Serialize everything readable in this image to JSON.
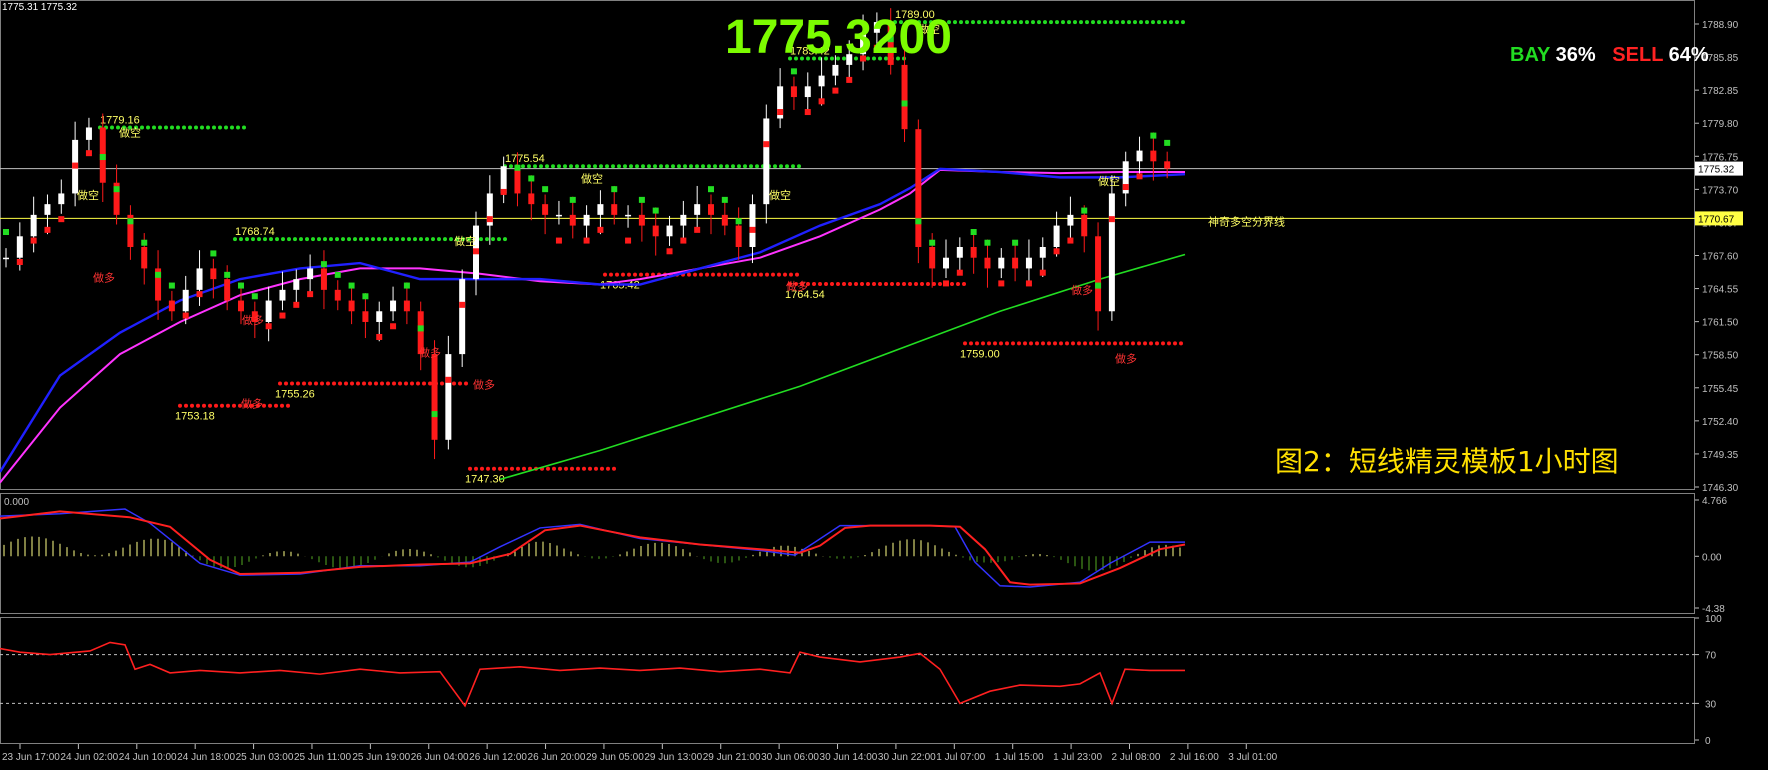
{
  "top_readout": "1775.31 1775.32",
  "big_price": "1775.3200",
  "sentiment": {
    "bay_label": "BAY",
    "bay_pct": "36%",
    "sell_label": "SELL",
    "sell_pct": "64%"
  },
  "caption": "图2：短线精灵模板1小时图",
  "divider_label": "神奇多空分界线",
  "colors": {
    "background": "#000000",
    "axis": "#c0c0c0",
    "buy": "#ff1a1a",
    "sell": "#22dd22",
    "ma_blue": "#2020ff",
    "ma_magenta": "#ff33ff",
    "ma_green": "#22dd22",
    "label_yellow": "#ffff66",
    "label_red": "#ff3333",
    "price_line": "#ffffff"
  },
  "chart_data": [
    {
      "type": "candlestick",
      "panel": "price",
      "ylim": [
        1745.5,
        1790.5
      ],
      "y_ticks": [
        "1788.90",
        "1785.85",
        "1782.85",
        "1779.80",
        "1776.75",
        "1773.70",
        "1770.67",
        "1767.60",
        "1764.55",
        "1761.50",
        "1758.50",
        "1755.45",
        "1752.40",
        "1749.35",
        "1746.30"
      ],
      "x_ticks": [
        "23 Jun 17:00",
        "24 Jun 02:00",
        "24 Jun 10:00",
        "24 Jun 18:00",
        "25 Jun 03:00",
        "25 Jun 11:00",
        "25 Jun 19:00",
        "26 Jun 04:00",
        "26 Jun 12:00",
        "26 Jun 20:00",
        "29 Jun 05:00",
        "29 Jun 13:00",
        "29 Jun 21:00",
        "30 Jun 06:00",
        "30 Jun 14:00",
        "30 Jun 22:00",
        "1 Jul 07:00",
        "1 Jul 15:00",
        "1 Jul 23:00",
        "2 Jul 08:00",
        "2 Jul 16:00",
        "3 Jul 01:00"
      ],
      "current_price": "1775.32",
      "current_price_value": 1775.32,
      "divider_price": "1770.67",
      "divider_price_value": 1770.67,
      "close_path": [
        1767,
        1769,
        1771,
        1772,
        1773,
        1778,
        1779.16,
        1774,
        1771,
        1768,
        1766,
        1763,
        1762,
        1764,
        1766,
        1765,
        1763,
        1762,
        1761,
        1763,
        1764,
        1765,
        1766,
        1764,
        1763,
        1762,
        1761,
        1762,
        1763,
        1762,
        1758,
        1750,
        1758,
        1765,
        1770,
        1773,
        1775.54,
        1773,
        1772,
        1771,
        1771,
        1770,
        1771,
        1772,
        1771,
        1771,
        1770,
        1769,
        1770,
        1771,
        1772,
        1771,
        1770,
        1768,
        1772,
        1780,
        1783,
        1782,
        1783,
        1784,
        1785,
        1786,
        1788,
        1789,
        1785,
        1779,
        1768,
        1766,
        1767,
        1768,
        1767,
        1766,
        1767,
        1766,
        1767,
        1768,
        1770,
        1771,
        1769,
        1762,
        1773,
        1776,
        1777,
        1776,
        1775.32
      ],
      "ma_blue": [
        [
          0,
          1747
        ],
        [
          60,
          1756
        ],
        [
          120,
          1760
        ],
        [
          180,
          1763
        ],
        [
          240,
          1765
        ],
        [
          300,
          1766
        ],
        [
          360,
          1766.5
        ],
        [
          420,
          1765
        ],
        [
          480,
          1765
        ],
        [
          540,
          1765
        ],
        [
          600,
          1764.5
        ],
        [
          640,
          1764.5
        ],
        [
          700,
          1766
        ],
        [
          760,
          1767.5
        ],
        [
          820,
          1770
        ],
        [
          880,
          1772
        ],
        [
          910,
          1773.5
        ],
        [
          940,
          1775.3
        ],
        [
          1000,
          1775
        ],
        [
          1060,
          1774.5
        ],
        [
          1120,
          1774.5
        ],
        [
          1185,
          1774.8
        ]
      ],
      "ma_magenta": [
        [
          0,
          1746
        ],
        [
          60,
          1753
        ],
        [
          120,
          1758
        ],
        [
          180,
          1761
        ],
        [
          240,
          1763.5
        ],
        [
          300,
          1765
        ],
        [
          360,
          1766
        ],
        [
          420,
          1766
        ],
        [
          480,
          1765.5
        ],
        [
          540,
          1764.8
        ],
        [
          600,
          1764.5
        ],
        [
          640,
          1765
        ],
        [
          700,
          1766
        ],
        [
          760,
          1767
        ],
        [
          820,
          1769
        ],
        [
          880,
          1771.5
        ],
        [
          910,
          1773
        ],
        [
          940,
          1775.2
        ],
        [
          1000,
          1775
        ],
        [
          1060,
          1774.9
        ],
        [
          1120,
          1775
        ],
        [
          1185,
          1775
        ]
      ],
      "ma_green": [
        [
          500,
          1746.3
        ],
        [
          600,
          1749
        ],
        [
          700,
          1752
        ],
        [
          800,
          1755
        ],
        [
          900,
          1758.5
        ],
        [
          1000,
          1762
        ],
        [
          1100,
          1765
        ],
        [
          1185,
          1767.3
        ]
      ],
      "resistance_lines": [
        {
          "label": "1779.16",
          "value": 1779.16,
          "x0": 100,
          "x1": 245
        },
        {
          "label": "1775.54",
          "value": 1775.54,
          "x0": 505,
          "x1": 800
        },
        {
          "label": "1768.74",
          "value": 1768.74,
          "x0": 235,
          "x1": 510
        },
        {
          "label": "1789.00",
          "value": 1789.0,
          "x0": 895,
          "x1": 1185
        },
        {
          "label": "1785.42",
          "value": 1785.6,
          "x0": 790,
          "x1": 905
        }
      ],
      "support_lines": [
        {
          "label": "1753.18",
          "value": 1753.18,
          "x0": 180,
          "x1": 290
        },
        {
          "label": "1755.26",
          "value": 1755.26,
          "x0": 280,
          "x1": 470
        },
        {
          "label": "1747.30",
          "value": 1747.3,
          "x0": 470,
          "x1": 615
        },
        {
          "label": "1765.42",
          "value": 1765.42,
          "x0": 605,
          "x1": 800
        },
        {
          "label": "1764.54",
          "value": 1764.54,
          "x0": 790,
          "x1": 965
        },
        {
          "label": "1759.00",
          "value": 1759.0,
          "x0": 965,
          "x1": 1185
        }
      ],
      "signal_labels": [
        {
          "text": "做空",
          "x": 88,
          "price": 1772.5,
          "side": "sell"
        },
        {
          "text": "做空",
          "x": 130,
          "price": 1778.3,
          "side": "sell"
        },
        {
          "text": "做空",
          "x": 465,
          "price": 1768.2,
          "side": "sell"
        },
        {
          "text": "做空",
          "x": 592,
          "price": 1774.0,
          "side": "sell"
        },
        {
          "text": "做空",
          "x": 780,
          "price": 1772.5,
          "side": "sell"
        },
        {
          "text": "做空",
          "x": 929,
          "price": 1788.0,
          "side": "sell"
        },
        {
          "text": "做空",
          "x": 1109,
          "price": 1773.8,
          "side": "sell"
        },
        {
          "text": "做多",
          "x": 104,
          "price": 1764.8,
          "side": "buy"
        },
        {
          "text": "做多",
          "x": 253,
          "price": 1760.8,
          "side": "buy"
        },
        {
          "text": "做多",
          "x": 252,
          "price": 1753.0,
          "side": "buy"
        },
        {
          "text": "做多",
          "x": 430,
          "price": 1757.8,
          "side": "buy"
        },
        {
          "text": "做多",
          "x": 484,
          "price": 1754.8,
          "side": "buy"
        },
        {
          "text": "做多",
          "x": 797,
          "price": 1764.0,
          "side": "buy"
        },
        {
          "text": "做多",
          "x": 1082,
          "price": 1763.6,
          "side": "buy"
        },
        {
          "text": "做多",
          "x": 1126,
          "price": 1757.2,
          "side": "buy"
        }
      ]
    },
    {
      "type": "line",
      "panel": "macd",
      "label": "0.000",
      "ylim": [
        -4.38,
        4.766
      ],
      "y_ticks": [
        "4.766",
        "0.00",
        "-4.38"
      ],
      "red_line": [
        [
          0,
          3.2
        ],
        [
          60,
          3.8
        ],
        [
          130,
          3.3
        ],
        [
          170,
          2.5
        ],
        [
          210,
          -0.3
        ],
        [
          240,
          -1.5
        ],
        [
          300,
          -1.4
        ],
        [
          360,
          -0.9
        ],
        [
          420,
          -0.7
        ],
        [
          470,
          -0.6
        ],
        [
          510,
          0.2
        ],
        [
          545,
          2.2
        ],
        [
          580,
          2.6
        ],
        [
          640,
          1.6
        ],
        [
          700,
          1.0
        ],
        [
          760,
          0.6
        ],
        [
          800,
          0.3
        ],
        [
          820,
          0.9
        ],
        [
          845,
          2.4
        ],
        [
          870,
          2.6
        ],
        [
          930,
          2.6
        ],
        [
          960,
          2.5
        ],
        [
          985,
          0.6
        ],
        [
          1010,
          -2.2
        ],
        [
          1030,
          -2.4
        ],
        [
          1080,
          -2.3
        ],
        [
          1120,
          -1.0
        ],
        [
          1160,
          0.6
        ],
        [
          1185,
          1.0
        ]
      ],
      "blue_line": [
        [
          0,
          3.4
        ],
        [
          60,
          3.6
        ],
        [
          125,
          4.0
        ],
        [
          150,
          2.8
        ],
        [
          200,
          -0.6
        ],
        [
          240,
          -1.6
        ],
        [
          300,
          -1.5
        ],
        [
          360,
          -0.8
        ],
        [
          420,
          -0.8
        ],
        [
          470,
          -0.5
        ],
        [
          500,
          0.8
        ],
        [
          540,
          2.4
        ],
        [
          580,
          2.7
        ],
        [
          640,
          1.5
        ],
        [
          700,
          1.0
        ],
        [
          760,
          0.5
        ],
        [
          795,
          0.1
        ],
        [
          815,
          1.2
        ],
        [
          840,
          2.6
        ],
        [
          870,
          2.6
        ],
        [
          930,
          2.6
        ],
        [
          955,
          2.5
        ],
        [
          975,
          -0.5
        ],
        [
          1000,
          -2.5
        ],
        [
          1030,
          -2.6
        ],
        [
          1080,
          -2.2
        ],
        [
          1110,
          -0.6
        ],
        [
          1150,
          1.2
        ],
        [
          1185,
          1.2
        ]
      ]
    },
    {
      "type": "line",
      "panel": "oscillator",
      "ylim": [
        0,
        100
      ],
      "y_ticks": [
        "100",
        "70",
        "30",
        "0"
      ],
      "levels": [
        70,
        30
      ],
      "values": [
        [
          0,
          75
        ],
        [
          20,
          72
        ],
        [
          50,
          70
        ],
        [
          90,
          73
        ],
        [
          110,
          80
        ],
        [
          125,
          78
        ],
        [
          135,
          58
        ],
        [
          150,
          62
        ],
        [
          170,
          55
        ],
        [
          200,
          57
        ],
        [
          240,
          55
        ],
        [
          280,
          57
        ],
        [
          320,
          54
        ],
        [
          360,
          58
        ],
        [
          400,
          55
        ],
        [
          440,
          56
        ],
        [
          465,
          28
        ],
        [
          480,
          58
        ],
        [
          520,
          60
        ],
        [
          560,
          57
        ],
        [
          600,
          59
        ],
        [
          640,
          57
        ],
        [
          680,
          59
        ],
        [
          720,
          56
        ],
        [
          760,
          58
        ],
        [
          790,
          55
        ],
        [
          800,
          72
        ],
        [
          820,
          68
        ],
        [
          860,
          64
        ],
        [
          900,
          68
        ],
        [
          920,
          71
        ],
        [
          940,
          58
        ],
        [
          960,
          30
        ],
        [
          990,
          40
        ],
        [
          1020,
          45
        ],
        [
          1060,
          44
        ],
        [
          1080,
          46
        ],
        [
          1100,
          55
        ],
        [
          1112,
          30
        ],
        [
          1125,
          58
        ],
        [
          1150,
          57
        ],
        [
          1185,
          57
        ]
      ]
    }
  ]
}
